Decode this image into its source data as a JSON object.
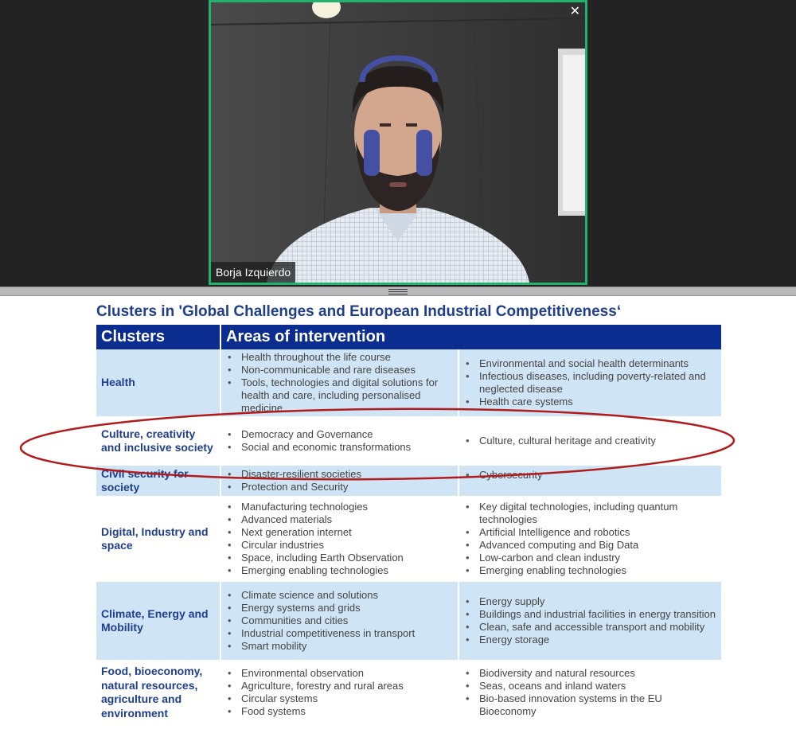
{
  "video": {
    "participant_name": "Borja Izquierdo",
    "close_label": "✕"
  },
  "slide": {
    "title": "Clusters in 'Global Challenges and European Industrial Competitiveness‘",
    "header_clusters": "Clusters",
    "header_areas": "Areas of intervention",
    "rows": [
      {
        "cluster": "Health",
        "left": [
          "Health throughout the life course",
          "Non-communicable and rare diseases",
          "Tools, technologies and digital solutions for health and care, including personalised medicine"
        ],
        "right": [
          "Environmental and social health determinants",
          "Infectious diseases, including poverty-related and neglected disease",
          "Health care systems"
        ]
      },
      {
        "cluster": "Culture, creativity and inclusive society",
        "left": [
          "Democracy and Governance",
          "Social and economic transformations"
        ],
        "right": [
          "Culture, cultural heritage and creativity"
        ]
      },
      {
        "cluster": "Civil security for society",
        "left": [
          "Disaster-resilient societies",
          "Protection and Security"
        ],
        "right": [
          "Cybersecurity"
        ]
      },
      {
        "cluster": "Digital,  Industry and space",
        "left": [
          "Manufacturing technologies",
          "Advanced materials",
          "Next generation internet",
          "Circular industries",
          "Space, including Earth Observation",
          "Emerging enabling technologies"
        ],
        "right": [
          "Key digital technologies, including quantum technologies",
          "Artificial Intelligence and robotics",
          "Advanced computing and Big Data",
          "Low-carbon and clean industry",
          "Emerging enabling technologies"
        ]
      },
      {
        "cluster": "Climate, Energy and Mobility",
        "left": [
          "Climate science and solutions",
          "Energy systems and grids",
          "Communities and cities",
          "Industrial competitiveness in transport",
          "Smart mobility"
        ],
        "right": [
          "Energy supply",
          "Buildings and industrial facilities in energy transition",
          "Clean, safe and accessible transport and mobility",
          "Energy storage"
        ]
      },
      {
        "cluster": "Food,  bioeconomy, natural resources, agriculture and environment",
        "left": [
          "Environmental observation",
          "Agriculture, forestry and rural areas",
          "Circular systems",
          "Food systems"
        ],
        "right": [
          "Biodiversity and natural resources",
          "Seas, oceans and inland waters",
          "Bio-based innovation systems in the EU Bioeconomy"
        ]
      }
    ]
  },
  "colors": {
    "tile_border": "#23b26d",
    "header_bg": "#0a2d8f",
    "row_blue": "#cfe4f5",
    "cluster_text": "#1f3e8c",
    "annotation": "#b01c1c"
  }
}
